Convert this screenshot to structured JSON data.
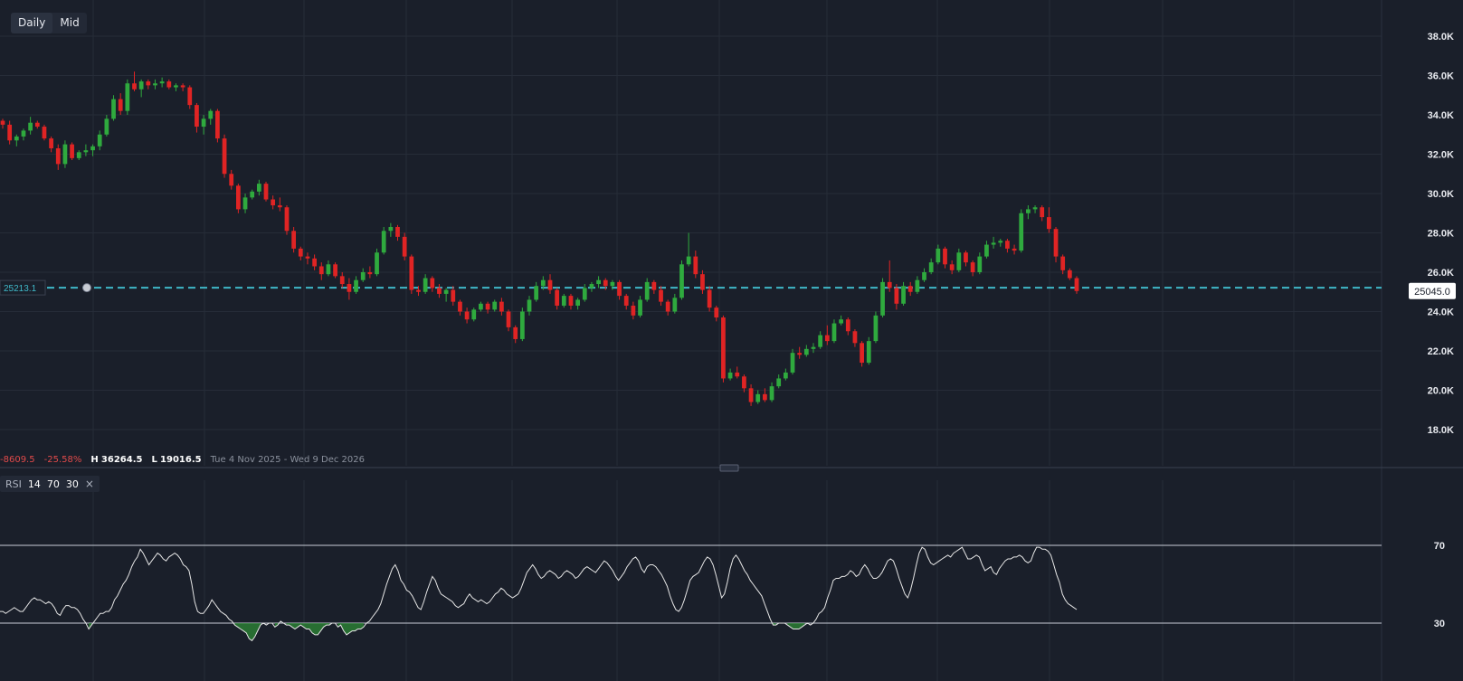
{
  "toolbar": {
    "tabs": [
      "Daily",
      "Mid"
    ]
  },
  "colors": {
    "background": "#1a1f2a",
    "grid": "#262c38",
    "up": "#2faa3e",
    "down": "#e02424",
    "level_line": "#3fb8c8",
    "rsi_line": "#e6e6e6",
    "rsi_fill": "#2d8a36"
  },
  "stats": {
    "change": "-8609.5",
    "change_pct": "-25.58%",
    "high_label": "H",
    "high": "36264.5",
    "low_label": "L",
    "low": "19016.5",
    "range": "Tue 4 Nov 2025 - Wed 9 Dec 2026"
  },
  "rsi_legend": {
    "name": "RSI",
    "period": "14",
    "upper": "70",
    "lower": "30",
    "close_icon": "×"
  },
  "chart_data": [
    {
      "type": "candlestick",
      "y_ticks": [
        "38.0K",
        "36.0K",
        "34.0K",
        "32.0K",
        "30.0K",
        "28.0K",
        "26.0K",
        "24.0K",
        "22.0K",
        "20.0K",
        "18.0K"
      ],
      "ylim": [
        16500,
        39300
      ],
      "grid": true,
      "level_line": {
        "value": 25213.1,
        "label": "25213.1"
      },
      "last_price": {
        "value": 25045,
        "label": "25045.0"
      },
      "candles": [
        [
          33700,
          33800,
          33300,
          33500
        ],
        [
          33500,
          33700,
          32500,
          32700
        ],
        [
          32700,
          33000,
          32400,
          32900
        ],
        [
          32900,
          33300,
          32700,
          33200
        ],
        [
          33200,
          33900,
          33000,
          33600
        ],
        [
          33600,
          33700,
          33300,
          33400
        ],
        [
          33400,
          33500,
          32700,
          32800
        ],
        [
          32800,
          32900,
          32100,
          32300
        ],
        [
          32300,
          32500,
          31200,
          31500
        ],
        [
          31500,
          32700,
          31300,
          32500
        ],
        [
          32500,
          32600,
          31700,
          31800
        ],
        [
          31800,
          32200,
          31700,
          32100
        ],
        [
          32100,
          32500,
          31900,
          32200
        ],
        [
          32200,
          32500,
          31900,
          32400
        ],
        [
          32400,
          33200,
          32200,
          33000
        ],
        [
          33000,
          34000,
          32900,
          33800
        ],
        [
          33800,
          35000,
          33700,
          34800
        ],
        [
          34800,
          35100,
          34000,
          34200
        ],
        [
          34200,
          35800,
          34000,
          35600
        ],
        [
          35600,
          36200,
          35200,
          35300
        ],
        [
          35300,
          35800,
          34900,
          35700
        ],
        [
          35700,
          35800,
          35300,
          35500
        ],
        [
          35500,
          35800,
          35300,
          35600
        ],
        [
          35600,
          35900,
          35400,
          35700
        ],
        [
          35700,
          35800,
          35300,
          35400
        ],
        [
          35400,
          35600,
          35200,
          35500
        ],
        [
          35500,
          35600,
          35200,
          35400
        ],
        [
          35400,
          35500,
          34300,
          34500
        ],
        [
          34500,
          34600,
          33100,
          33400
        ],
        [
          33400,
          34000,
          33000,
          33800
        ],
        [
          33800,
          34300,
          33500,
          34200
        ],
        [
          34200,
          34300,
          32600,
          32800
        ],
        [
          32800,
          33000,
          30800,
          31000
        ],
        [
          31000,
          31200,
          30200,
          30400
        ],
        [
          30400,
          30500,
          29000,
          29200
        ],
        [
          29200,
          30000,
          29000,
          29800
        ],
        [
          29800,
          30200,
          29700,
          30100
        ],
        [
          30100,
          30700,
          29900,
          30500
        ],
        [
          30500,
          30600,
          29600,
          29700
        ],
        [
          29700,
          29900,
          29200,
          29400
        ],
        [
          29400,
          29800,
          29100,
          29300
        ],
        [
          29300,
          29400,
          27900,
          28100
        ],
        [
          28100,
          28300,
          27000,
          27200
        ],
        [
          27200,
          27300,
          26600,
          26800
        ],
        [
          26800,
          27000,
          26400,
          26700
        ],
        [
          26700,
          26900,
          26100,
          26300
        ],
        [
          26300,
          26500,
          25600,
          25900
        ],
        [
          25900,
          26600,
          25800,
          26400
        ],
        [
          26400,
          26500,
          25700,
          25800
        ],
        [
          25800,
          26000,
          25200,
          25400
        ],
        [
          25400,
          25700,
          24600,
          25000
        ],
        [
          25000,
          25800,
          24900,
          25600
        ],
        [
          25600,
          26200,
          25500,
          26000
        ],
        [
          26000,
          26300,
          25700,
          25900
        ],
        [
          25900,
          27200,
          25800,
          27000
        ],
        [
          27000,
          28300,
          26900,
          28100
        ],
        [
          28100,
          28500,
          27800,
          28300
        ],
        [
          28300,
          28400,
          27600,
          27800
        ],
        [
          27800,
          28000,
          26600,
          26800
        ],
        [
          26800,
          26900,
          24900,
          25100
        ],
        [
          25100,
          25300,
          24800,
          25000
        ],
        [
          25000,
          25900,
          24900,
          25700
        ],
        [
          25700,
          25800,
          25000,
          25200
        ],
        [
          25200,
          25400,
          24700,
          24900
        ],
        [
          24900,
          25200,
          24500,
          25100
        ],
        [
          25100,
          25300,
          24300,
          24500
        ],
        [
          24500,
          24600,
          23800,
          24000
        ],
        [
          24000,
          24200,
          23400,
          23600
        ],
        [
          23600,
          24200,
          23500,
          24100
        ],
        [
          24100,
          24500,
          24000,
          24400
        ],
        [
          24400,
          24500,
          23900,
          24100
        ],
        [
          24100,
          24600,
          24000,
          24500
        ],
        [
          24500,
          24700,
          23800,
          24000
        ],
        [
          24000,
          24100,
          23000,
          23200
        ],
        [
          23200,
          23300,
          22400,
          22600
        ],
        [
          22600,
          24200,
          22500,
          24000
        ],
        [
          24000,
          24800,
          23800,
          24600
        ],
        [
          24600,
          25500,
          24500,
          25300
        ],
        [
          25300,
          25800,
          25100,
          25600
        ],
        [
          25600,
          25900,
          24900,
          25100
        ],
        [
          25100,
          25200,
          24100,
          24300
        ],
        [
          24300,
          24900,
          24200,
          24800
        ],
        [
          24800,
          24900,
          24100,
          24300
        ],
        [
          24300,
          24700,
          24100,
          24600
        ],
        [
          24600,
          25400,
          24500,
          25200
        ],
        [
          25200,
          25500,
          25000,
          25400
        ],
        [
          25400,
          25800,
          25200,
          25600
        ],
        [
          25600,
          25700,
          25100,
          25300
        ],
        [
          25300,
          25600,
          25100,
          25500
        ],
        [
          25500,
          25600,
          24600,
          24800
        ],
        [
          24800,
          24900,
          24100,
          24300
        ],
        [
          24300,
          24500,
          23600,
          23800
        ],
        [
          23800,
          24800,
          23700,
          24600
        ],
        [
          24600,
          25700,
          24500,
          25500
        ],
        [
          25500,
          25600,
          24900,
          25100
        ],
        [
          25100,
          25300,
          24300,
          24500
        ],
        [
          24500,
          24600,
          23800,
          24000
        ],
        [
          24000,
          24900,
          23900,
          24700
        ],
        [
          24700,
          26600,
          24600,
          26400
        ],
        [
          26400,
          28000,
          26300,
          26800
        ],
        [
          26800,
          27100,
          25700,
          25900
        ],
        [
          25900,
          26100,
          24900,
          25100
        ],
        [
          25100,
          25300,
          24000,
          24200
        ],
        [
          24200,
          24300,
          23500,
          23700
        ],
        [
          23700,
          23800,
          20400,
          20600
        ],
        [
          20600,
          21100,
          20500,
          20900
        ],
        [
          20900,
          21200,
          20600,
          20700
        ],
        [
          20700,
          20800,
          19900,
          20100
        ],
        [
          20100,
          20300,
          19200,
          19400
        ],
        [
          19400,
          20000,
          19300,
          19800
        ],
        [
          19800,
          20100,
          19400,
          19500
        ],
        [
          19500,
          20400,
          19400,
          20200
        ],
        [
          20200,
          20800,
          20100,
          20600
        ],
        [
          20600,
          21100,
          20500,
          20900
        ],
        [
          20900,
          22100,
          20800,
          21900
        ],
        [
          21900,
          22200,
          21600,
          21800
        ],
        [
          21800,
          22300,
          21700,
          22100
        ],
        [
          22100,
          22400,
          21900,
          22200
        ],
        [
          22200,
          23000,
          22100,
          22800
        ],
        [
          22800,
          23300,
          22300,
          22500
        ],
        [
          22500,
          23600,
          22400,
          23400
        ],
        [
          23400,
          23800,
          23300,
          23600
        ],
        [
          23600,
          23700,
          22800,
          23000
        ],
        [
          23000,
          23100,
          22200,
          22400
        ],
        [
          22400,
          22500,
          21200,
          21400
        ],
        [
          21400,
          22700,
          21300,
          22500
        ],
        [
          22500,
          24000,
          22400,
          23800
        ],
        [
          23800,
          25700,
          23700,
          25500
        ],
        [
          25500,
          26600,
          25000,
          25200
        ],
        [
          25200,
          25400,
          24100,
          24400
        ],
        [
          24400,
          25500,
          24300,
          25300
        ],
        [
          25300,
          25500,
          24800,
          25000
        ],
        [
          25000,
          25800,
          24900,
          25600
        ],
        [
          25600,
          26200,
          25500,
          26000
        ],
        [
          26000,
          26700,
          25900,
          26500
        ],
        [
          26500,
          27400,
          26400,
          27200
        ],
        [
          27200,
          27300,
          26200,
          26400
        ],
        [
          26400,
          26600,
          25900,
          26100
        ],
        [
          26100,
          27200,
          26000,
          27000
        ],
        [
          27000,
          27100,
          26300,
          26500
        ],
        [
          26500,
          26600,
          25800,
          26000
        ],
        [
          26000,
          27000,
          25900,
          26800
        ],
        [
          26800,
          27600,
          26700,
          27400
        ],
        [
          27400,
          27800,
          27200,
          27500
        ],
        [
          27500,
          27700,
          27300,
          27600
        ],
        [
          27600,
          27700,
          27000,
          27200
        ],
        [
          27200,
          27400,
          26900,
          27100
        ],
        [
          27100,
          29200,
          27000,
          29000
        ],
        [
          29000,
          29400,
          28700,
          29200
        ],
        [
          29200,
          29400,
          29000,
          29300
        ],
        [
          29300,
          29400,
          28600,
          28800
        ],
        [
          28800,
          29300,
          28000,
          28200
        ],
        [
          28200,
          28300,
          26500,
          26800
        ],
        [
          26800,
          26900,
          25900,
          26100
        ],
        [
          26100,
          26200,
          25600,
          25700
        ],
        [
          25700,
          25800,
          24900,
          25045
        ]
      ]
    },
    {
      "type": "line",
      "name": "RSI",
      "y_ticks": [
        "70",
        "30"
      ],
      "levels": [
        70,
        30
      ],
      "values": [
        36,
        36,
        35,
        36,
        37,
        38,
        37,
        36,
        36,
        38,
        40,
        42,
        43,
        42,
        42,
        41,
        40,
        41,
        40,
        38,
        35,
        34,
        37,
        39,
        39,
        38,
        38,
        37,
        35,
        32,
        30,
        27,
        29,
        31,
        33,
        35,
        35,
        36,
        36,
        38,
        42,
        44,
        47,
        50,
        52,
        55,
        59,
        62,
        64,
        68,
        66,
        63,
        60,
        62,
        64,
        66,
        65,
        63,
        62,
        64,
        65,
        66,
        65,
        63,
        60,
        59,
        57,
        50,
        41,
        36,
        35,
        35,
        37,
        39,
        42,
        40,
        38,
        36,
        35,
        34,
        32,
        31,
        29,
        28,
        27,
        26,
        25,
        22,
        21,
        23,
        26,
        29,
        30,
        29,
        30,
        30,
        28,
        29,
        31,
        30,
        29,
        29,
        28,
        27,
        28,
        29,
        28,
        27,
        27,
        25,
        24,
        24,
        26,
        28,
        29,
        29,
        30,
        30,
        28,
        29,
        26,
        24,
        25,
        26,
        26,
        27,
        27,
        28,
        30,
        31,
        33,
        35,
        37,
        40,
        45,
        50,
        54,
        58,
        60,
        57,
        52,
        50,
        47,
        46,
        44,
        41,
        38,
        37,
        41,
        46,
        50,
        54,
        52,
        48,
        45,
        44,
        43,
        42,
        41,
        39,
        38,
        39,
        40,
        43,
        45,
        43,
        42,
        41,
        42,
        41,
        40,
        41,
        43,
        45,
        46,
        48,
        47,
        45,
        44,
        43,
        44,
        45,
        48,
        52,
        56,
        58,
        60,
        58,
        55,
        53,
        54,
        56,
        57,
        56,
        55,
        53,
        54,
        56,
        57,
        56,
        55,
        53,
        54,
        56,
        58,
        59,
        58,
        57,
        56,
        58,
        60,
        62,
        61,
        59,
        57,
        54,
        52,
        54,
        56,
        59,
        61,
        63,
        64,
        62,
        58,
        56,
        59,
        60,
        60,
        59,
        57,
        55,
        52,
        49,
        44,
        40,
        37,
        36,
        38,
        42,
        47,
        52,
        54,
        55,
        56,
        59,
        62,
        64,
        63,
        60,
        55,
        49,
        43,
        45,
        51,
        58,
        63,
        65,
        63,
        60,
        57,
        55,
        52,
        50,
        48,
        46,
        44,
        40,
        36,
        32,
        29,
        29,
        30,
        30,
        30,
        29,
        28,
        27,
        27,
        27,
        28,
        29,
        30,
        29,
        30,
        32,
        35,
        36,
        38,
        43,
        47,
        52,
        53,
        53,
        54,
        54,
        55,
        57,
        56,
        54,
        55,
        58,
        60,
        58,
        55,
        53,
        53,
        54,
        56,
        59,
        62,
        63,
        62,
        58,
        53,
        49,
        45,
        43,
        47,
        53,
        60,
        66,
        69,
        68,
        64,
        61,
        60,
        61,
        62,
        63,
        64,
        65,
        64,
        66,
        67,
        68,
        69,
        66,
        63,
        63,
        64,
        65,
        64,
        60,
        57,
        58,
        59,
        56,
        55,
        58,
        60,
        62,
        63,
        63,
        64,
        64,
        65,
        64,
        62,
        61,
        62,
        66,
        69,
        69,
        68,
        68,
        67,
        65,
        60,
        55,
        51,
        45,
        42,
        40,
        39,
        38,
        37
      ]
    }
  ]
}
